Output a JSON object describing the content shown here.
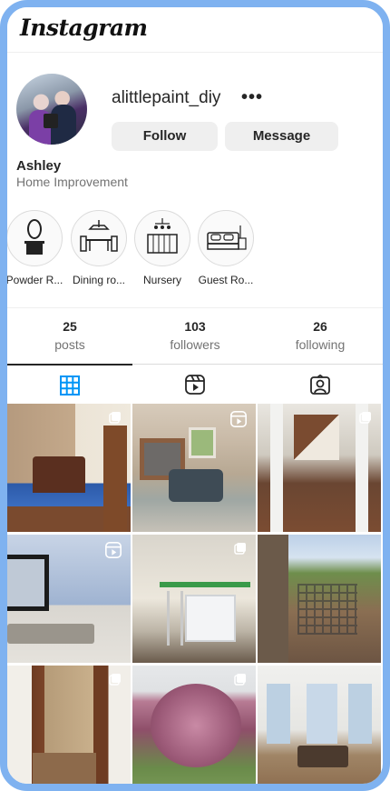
{
  "header": {
    "logo_text": "Instagram"
  },
  "profile": {
    "username": "alittlepaint_diy",
    "more_label": "•••",
    "follow_label": "Follow",
    "message_label": "Message",
    "full_name": "Ashley",
    "category": "Home Improvement"
  },
  "highlights": [
    {
      "label": "Powder R...",
      "icon": "vanity-icon"
    },
    {
      "label": "Dining ro...",
      "icon": "dining-table-icon"
    },
    {
      "label": "Nursery",
      "icon": "crib-icon"
    },
    {
      "label": "Guest Ro...",
      "icon": "bed-icon"
    }
  ],
  "stats": {
    "posts": {
      "count": "25",
      "label": "posts"
    },
    "followers": {
      "count": "103",
      "label": "followers"
    },
    "following": {
      "count": "26",
      "label": "following"
    }
  },
  "tabs": [
    {
      "name": "posts-grid",
      "icon": "grid-icon",
      "active": true
    },
    {
      "name": "reels",
      "icon": "reels-icon",
      "active": false
    },
    {
      "name": "tagged",
      "icon": "tagged-icon",
      "active": false
    }
  ],
  "posts": [
    {
      "subject": "bedroom",
      "badge": "carousel-icon"
    },
    {
      "subject": "living-room-fireplace",
      "badge": "reel-icon"
    },
    {
      "subject": "hallway-staircase",
      "badge": "carousel-icon"
    },
    {
      "subject": "powder-room",
      "badge": "reel-icon"
    },
    {
      "subject": "room-renovation",
      "badge": "carousel-icon"
    },
    {
      "subject": "backyard-fence",
      "badge": "none"
    },
    {
      "subject": "doorway",
      "badge": "carousel-icon"
    },
    {
      "subject": "blossom-tree",
      "badge": "carousel-icon"
    },
    {
      "subject": "dining-room",
      "badge": "none"
    }
  ],
  "colors": {
    "accent_blue": "#0095f6",
    "frame": "#7fb2f0",
    "button_bg": "#efefef"
  }
}
